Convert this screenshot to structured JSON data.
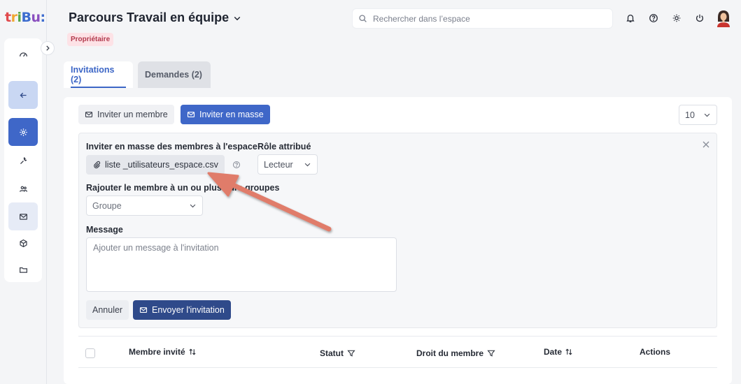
{
  "app": {
    "logo_text": "tribu:",
    "space_title": "Parcours Travail en équipe",
    "role_badge": "Propriétaire",
    "search_placeholder": "Rechercher dans l’espace"
  },
  "tabs": [
    {
      "label": "Invitations (2)",
      "active": true
    },
    {
      "label": "Demandes (2)",
      "active": false
    }
  ],
  "toolbar": {
    "invite_member_label": "Inviter un membre",
    "invite_bulk_label": "Inviter en masse",
    "page_size": "10"
  },
  "bulk_invite": {
    "section_label": "Inviter en masse des membres à l'espace",
    "file_name": "liste _utilisateurs_espace.csv",
    "role_label": "Rôle attribué",
    "role_value": "Lecteur",
    "group_label": "Rajouter le membre à un ou plusieurs groupes",
    "group_placeholder": "Groupe",
    "message_label": "Message",
    "message_placeholder": "Ajouter un message à l'invitation",
    "cancel_label": "Annuler",
    "send_label": "Envoyer l'invitation"
  },
  "table": {
    "columns": [
      "Membre invité",
      "Statut",
      "Droit du membre",
      "Date",
      "Actions"
    ]
  },
  "colors": {
    "primary": "#3f67c8",
    "send_button": "#2f4a8a",
    "badge_bg": "#fde2e6",
    "annotation_arrow": "#e07b6a"
  }
}
